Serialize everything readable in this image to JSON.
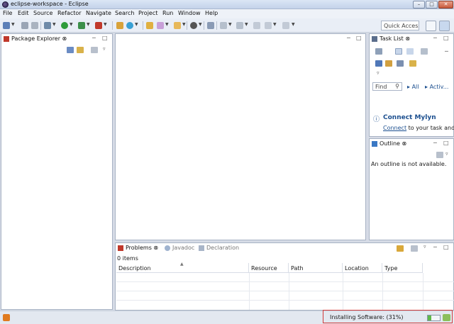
{
  "window": {
    "title": "eclipse-workspace - Eclipse",
    "min_glyph": "–",
    "max_glyph": "□",
    "close_glyph": "✕"
  },
  "menu": [
    "File",
    "Edit",
    "Source",
    "Refactor",
    "Navigate",
    "Search",
    "Project",
    "Run",
    "Window",
    "Help"
  ],
  "toolbar": {
    "quick_access": "Quick Access"
  },
  "package_explorer": {
    "title": "Package Explorer ⊗"
  },
  "task_list": {
    "title": "Task List ⊗",
    "find_placeholder": "Find",
    "filter_all": "All",
    "filter_activate": "Activ..."
  },
  "mylyn": {
    "title": "Connect Mylyn",
    "link": "Connect",
    "text": " to your task and A"
  },
  "outline": {
    "title": "Outline ⊗",
    "message": "An outline is not available."
  },
  "bottom_tabs": {
    "problems": "Problems ⊗",
    "javadoc": "Javadoc",
    "declaration": "Declaration"
  },
  "problems": {
    "count": "0 items",
    "columns": [
      "Description",
      "Resource",
      "Path",
      "Location",
      "Type"
    ]
  },
  "status": {
    "progress_text": "Installing Software: (31%)",
    "progress": 0.31
  },
  "colors": {
    "highlight": "#d03a3a",
    "mylyn_blue": "#1c4f8f"
  }
}
